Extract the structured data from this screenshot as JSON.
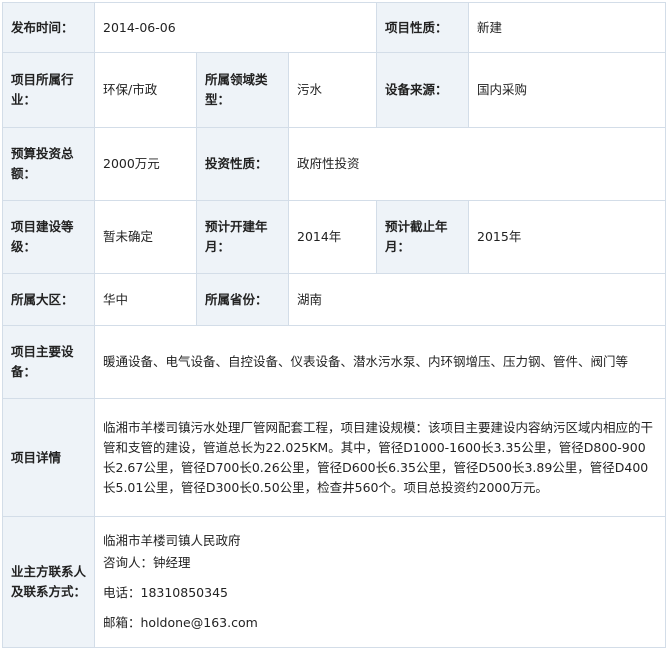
{
  "rows": {
    "publish_time": {
      "label": "发布时间：",
      "value": "2014-06-06"
    },
    "project_nature": {
      "label": "项目性质：",
      "value": "新建"
    },
    "industry": {
      "label": "项目所属行业：",
      "value": "环保/市政"
    },
    "field_type": {
      "label": "所属领域类型：",
      "value": "污水"
    },
    "equipment_source": {
      "label": "设备来源：",
      "value": "国内采购"
    },
    "budget": {
      "label": "预算投资总额：",
      "value": "2000万元"
    },
    "investment_nature": {
      "label": "投资性质：",
      "value": "政府性投资"
    },
    "build_level": {
      "label": "项目建设等级：",
      "value": "暂未确定"
    },
    "start_year": {
      "label": "预计开建年月：",
      "value": "2014年"
    },
    "end_year": {
      "label": "预计截止年月：",
      "value": "2015年"
    },
    "region": {
      "label": "所属大区：",
      "value": "华中"
    },
    "province": {
      "label": "所属省份：",
      "value": "湖南"
    },
    "main_equipment": {
      "label": "项目主要设备：",
      "value": "暖通设备、电气设备、自控设备、仪表设备、潜水污水泵、内环钢增压、压力钢、管件、阀门等"
    },
    "details": {
      "label": "项目详情",
      "value": "临湘市羊楼司镇污水处理厂管网配套工程，项目建设规模：该项目主要建设内容纳污区域内相应的干管和支管的建设，管道总长为22.025KM。其中，管径D1000-1600长3.35公里，管径D800-900长2.67公里，管径D700长0.26公里，管径D600长6.35公里，管径D500长3.89公里，管径D400长5.01公里，管径D300长0.50公里，检查井560个。项目总投资约2000万元。"
    },
    "contact": {
      "label": "业主方联系人及联系方式：",
      "org": "临湘市羊楼司镇人民政府",
      "consultant": "咨询人：钟经理",
      "phone": "电话：18310850345",
      "email": "邮箱：holdone@163.com"
    }
  }
}
